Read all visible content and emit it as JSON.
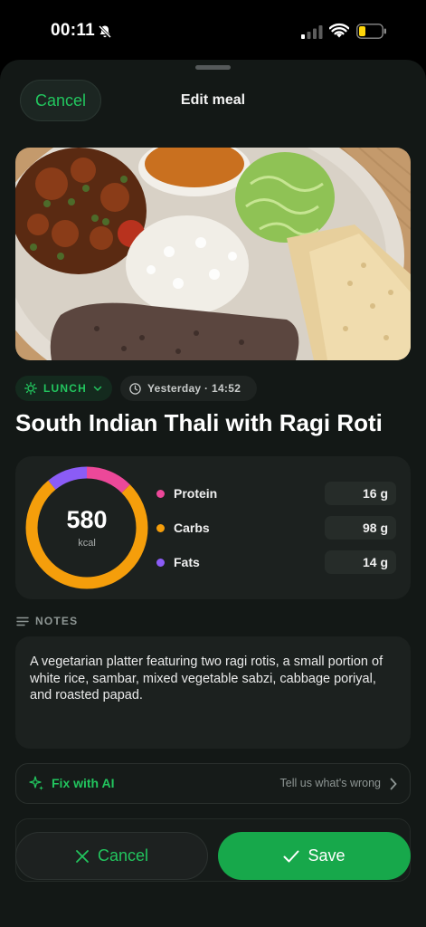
{
  "status_bar": {
    "time": "00:11",
    "icons": [
      "bell-off-icon",
      "cellular-signal-icon",
      "wifi-icon",
      "battery-low-icon"
    ]
  },
  "header": {
    "cancel_label": "Cancel",
    "title": "Edit meal"
  },
  "photo": {
    "description_icon": "meal-photo"
  },
  "meta": {
    "meal_type": "LUNCH",
    "meal_type_icon": "sun-icon",
    "time_label": "Yesterday · 14:52",
    "time_icon": "clock-icon"
  },
  "meal": {
    "title": "South Indian Thali with Ragi Roti"
  },
  "nutrition": {
    "calories": "580",
    "calories_unit": "kcal",
    "macros": [
      {
        "name": "Protein",
        "value": "16 g",
        "color": "#ec4899",
        "grams": 16
      },
      {
        "name": "Carbs",
        "value": "98 g",
        "color": "#f59e0b",
        "grams": 98
      },
      {
        "name": "Fats",
        "value": "14 g",
        "color": "#8b5cf6",
        "grams": 14
      }
    ]
  },
  "notes": {
    "label": "NOTES",
    "text": "A vegetarian platter featuring two ragi rotis, a small portion of white rice, sambar, mixed vegetable sabzi, cabbage poriyal, and roasted papad."
  },
  "fix_ai": {
    "label": "Fix with AI",
    "hint": "Tell us what's wrong"
  },
  "actions": {
    "cancel_label": "Cancel",
    "save_label": "Save"
  },
  "colors": {
    "accent": "#22c55e",
    "save_button": "#17a84b",
    "background": "#131816"
  }
}
